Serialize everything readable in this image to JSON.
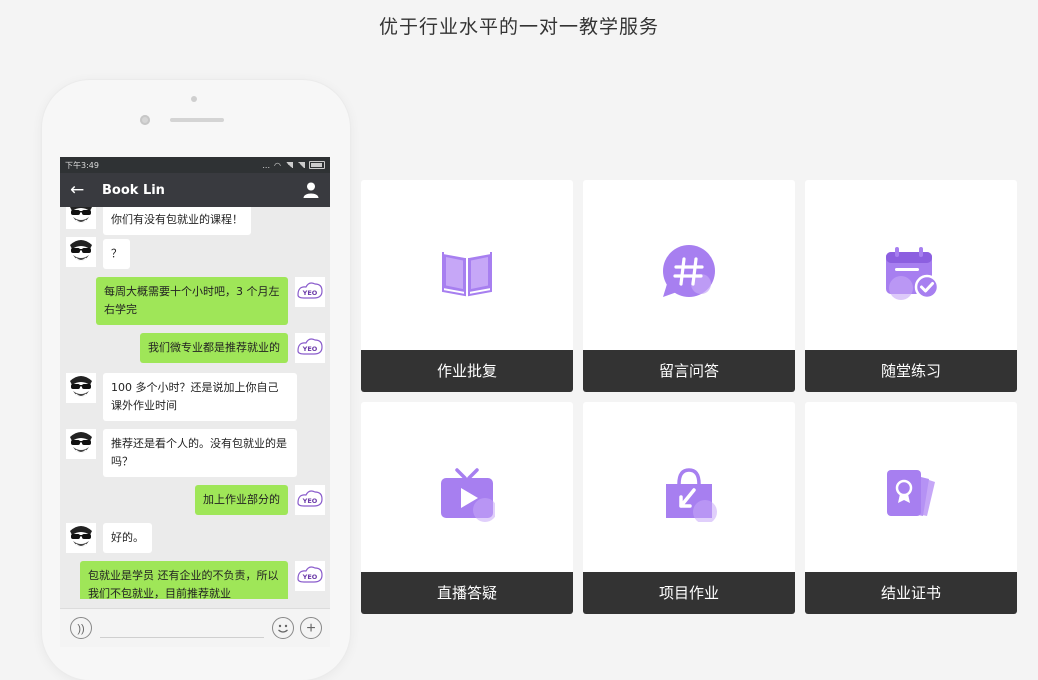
{
  "headline": "优于行业水平的一对一教学服务",
  "phone": {
    "status_time": "下午3:49",
    "status_dots": "...",
    "chat_title": "Book Lin",
    "messages": [
      {
        "side": "left",
        "text": "你们有没有包就业的课程！"
      },
      {
        "side": "left",
        "text": "？"
      },
      {
        "side": "right",
        "text": "每周大概需要十个小时吧，3 个月左右学完"
      },
      {
        "side": "right",
        "text": "我们微专业都是推荐就业的"
      },
      {
        "side": "left",
        "text": "100 多个小时？还是说加上你自己课外作业时间"
      },
      {
        "side": "left",
        "text": "推荐还是看个人的。没有包就业的是吗？"
      },
      {
        "side": "right",
        "text": "加上作业部分的"
      },
      {
        "side": "left",
        "text": "好的。"
      },
      {
        "side": "right",
        "text": "包就业是学员 还有企业的不负责，所以我们不包就业，目前推荐就业"
      }
    ],
    "avatar_brand_text": "YEO"
  },
  "services": [
    {
      "label": "作业批复",
      "icon": "book-icon"
    },
    {
      "label": "留言问答",
      "icon": "hashtag-chat-icon"
    },
    {
      "label": "随堂练习",
      "icon": "calendar-check-icon"
    },
    {
      "label": "直播答疑",
      "icon": "tv-play-icon"
    },
    {
      "label": "项目作业",
      "icon": "bag-download-icon"
    },
    {
      "label": "结业证书",
      "icon": "certificate-icon"
    }
  ],
  "colors": {
    "accent": "#a77ff0",
    "accent_light": "#c6a7f7",
    "label_bar": "#333333",
    "bubble_green": "#9fe658",
    "titlebar": "#393a3f"
  }
}
